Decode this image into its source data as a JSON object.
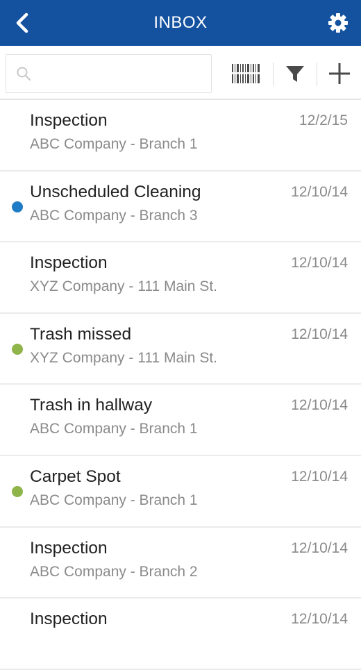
{
  "header": {
    "title": "INBOX",
    "back_icon": "chevron-left-icon",
    "settings_icon": "gear-icon",
    "color": "#1452a0"
  },
  "toolbar": {
    "search_placeholder": "",
    "search_value": "",
    "buttons": [
      "barcode-icon",
      "filter-icon",
      "plus-icon"
    ]
  },
  "status_colors": {
    "blue": "#1f7cc4",
    "green": "#8fb44a"
  },
  "items": [
    {
      "title": "Inspection",
      "subtitle": "ABC Company - Branch 1",
      "date": "12/2/15",
      "dot": ""
    },
    {
      "title": "Unscheduled Cleaning",
      "subtitle": "ABC Company - Branch 3",
      "date": "12/10/14",
      "dot": "#1f7cc4"
    },
    {
      "title": "Inspection",
      "subtitle": "XYZ Company - 111 Main St.",
      "date": "12/10/14",
      "dot": ""
    },
    {
      "title": "Trash missed",
      "subtitle": "XYZ Company - 111 Main St.",
      "date": "12/10/14",
      "dot": "#8fb44a"
    },
    {
      "title": "Trash in hallway",
      "subtitle": "ABC Company - Branch 1",
      "date": "12/10/14",
      "dot": ""
    },
    {
      "title": "Carpet Spot",
      "subtitle": "ABC Company - Branch 1",
      "date": "12/10/14",
      "dot": "#8fb44a"
    },
    {
      "title": "Inspection",
      "subtitle": "ABC Company - Branch 2",
      "date": "12/10/14",
      "dot": ""
    },
    {
      "title": "Inspection",
      "subtitle": "",
      "date": "12/10/14",
      "dot": ""
    }
  ]
}
